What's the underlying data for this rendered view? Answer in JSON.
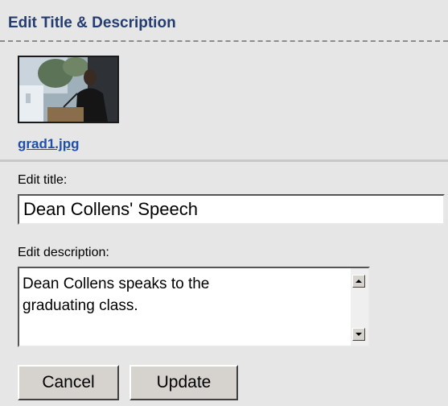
{
  "header": {
    "title": "Edit Title & Description"
  },
  "photo": {
    "filename": "grad1.jpg",
    "thumbnail_icon": "photo-thumbnail-icon"
  },
  "form": {
    "title_label": "Edit title:",
    "title_value": "Dean Collens' Speech",
    "description_label": "Edit description:",
    "description_value": "Dean Collens speaks to the\ngraduating class."
  },
  "buttons": {
    "cancel_label": "Cancel",
    "update_label": "Update"
  },
  "colors": {
    "header_text": "#243d6e",
    "link": "#1f4fa8",
    "panel_bg": "#e6e6e6"
  }
}
